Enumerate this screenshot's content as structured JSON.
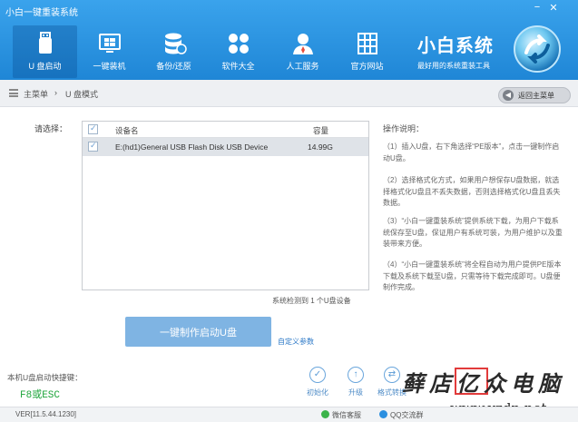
{
  "window": {
    "title": "小白一键重装系统",
    "minimize_icon": "minimize-icon",
    "close_icon": "close-icon"
  },
  "nav": {
    "items": [
      {
        "label": "U 盘启动",
        "icon": "usb-drive-icon",
        "active": true
      },
      {
        "label": "一键装机",
        "icon": "windows-icon"
      },
      {
        "label": "备份/还原",
        "icon": "database-icon"
      },
      {
        "label": "软件大全",
        "icon": "apps-icon"
      },
      {
        "label": "人工服务",
        "icon": "person-icon"
      },
      {
        "label": "官方网站",
        "icon": "website-icon"
      }
    ]
  },
  "brand": {
    "name": "小白系统",
    "slogan": "最好用的系统重装工具",
    "logo_icon": "brand-logo-icon"
  },
  "breadcrumb": {
    "home": "主菜单",
    "separator": "›",
    "current": "U 盘模式",
    "back_label": "返回主菜单"
  },
  "device_panel": {
    "select_label": "请选择：",
    "columns": [
      "设备名",
      "容量"
    ],
    "rows": [
      {
        "name": "E:(hd1)General USB Flash Disk USB Device",
        "capacity": "14.99G",
        "checked": true
      }
    ],
    "detected_text": "系统检测到 1 个U盘设备"
  },
  "instructions": {
    "title": "操作说明：",
    "steps": [
      "（1）插入U盘，右下角选择“PE版本”，点击一键制作启动U盘。",
      "（2）选择格式化方式，如果用户想保存U盘数据，就选择格式化U盘且不丢失数据，否则选择格式化U盘且丢失数据。",
      "（3）“小白一键重装系统”提供系统下载，为用户下载系统保存至U盘，保证用户有系统可装，为用户维护以及重装带来方便。",
      "（4）“小白一键重装系统”将全程自动为用户提供PE版本下载及系统下载至U盘，只需等待下载完成即可。U盘便制作完成。"
    ]
  },
  "actions": {
    "make_button": "一键制作启动U盘",
    "custom_link": "自定义参数"
  },
  "hotkey": {
    "label": "本机U盘启动快捷键：",
    "value": "F8或ESC"
  },
  "tools": [
    {
      "label": "初始化",
      "icon": "check-circle-icon"
    },
    {
      "label": "升级",
      "icon": "upload-icon"
    },
    {
      "label": "格式转换",
      "icon": "convert-icon"
    }
  ],
  "watermark": {
    "text": "藓店亿众电脑",
    "url": "www.yzdn.net"
  },
  "footer": {
    "version": "VER[11.5.44.1230]",
    "wechat": "微信客服",
    "qq": "QQ交流群"
  },
  "colors": {
    "header": "#2a95e2",
    "accent": "#7fb4e3",
    "hotkey": "#1ea53b",
    "link": "#2b78c7"
  }
}
